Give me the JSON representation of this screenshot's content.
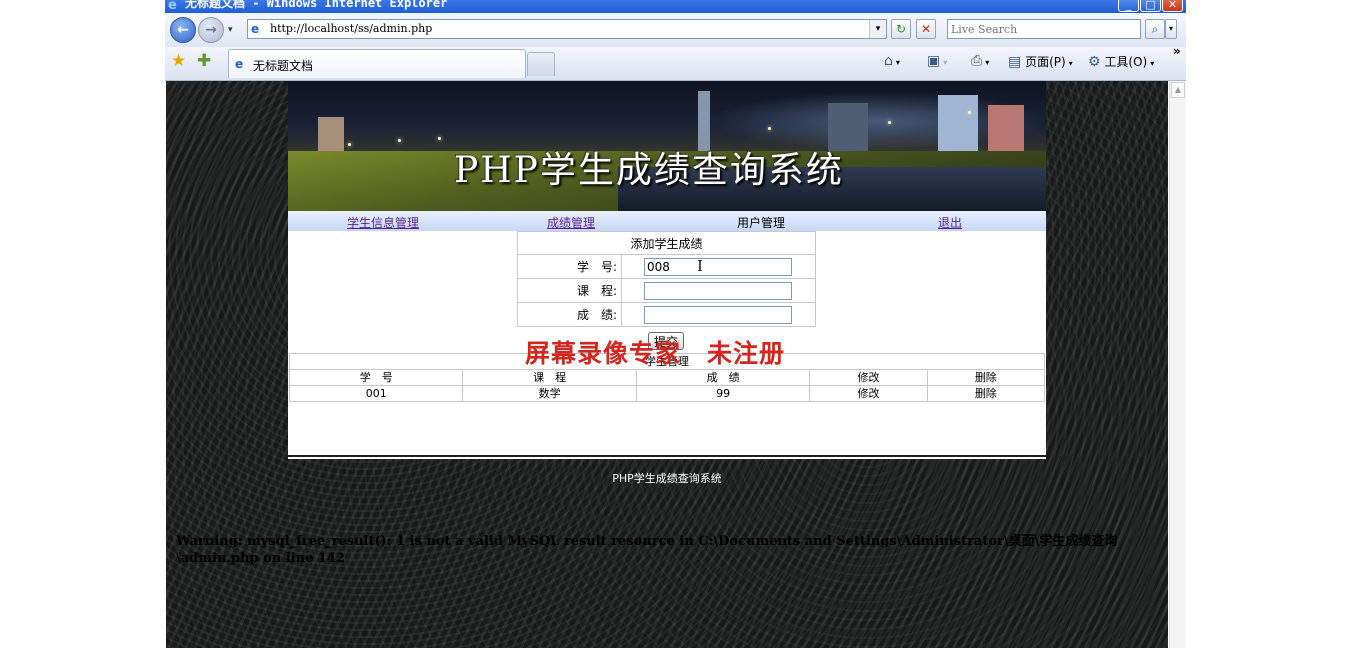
{
  "window": {
    "title": "无标题文档 - Windows Internet Explorer",
    "minimize": "_",
    "maximize": "□",
    "close": "✕"
  },
  "toolbar": {
    "back": "←",
    "forward": "→",
    "nav_dropdown": "▾",
    "address": "http://localhost/ss/admin.php",
    "address_dropdown": "▾",
    "refresh": "↻",
    "stop": "✕",
    "search_placeholder": "Live Search",
    "search_go": "⌕",
    "search_dropdown": "▾"
  },
  "tabs": {
    "active_label": "无标题文档"
  },
  "commands": {
    "home": "⌂",
    "feeds": "▣",
    "print": "⎙",
    "page_label": "页面(P)",
    "tools_label": "工具(O)",
    "more": "»"
  },
  "page": {
    "banner_title": "PHP学生成绩查询系统",
    "menu": {
      "student_info": "学生信息管理",
      "score_mgmt": "成绩管理",
      "user_mgmt": "用户管理",
      "logout": "退出"
    },
    "form": {
      "caption": "添加学生成绩",
      "student_id_label": "学　号:",
      "student_id_value": "008",
      "course_label": "课　程:",
      "course_value": "",
      "score_label": "成　绩:",
      "score_value": "",
      "submit_label": "提交"
    },
    "watermark": "屏幕录像专家　未注册",
    "table": {
      "title": "学生管理",
      "headers": [
        "学　号",
        "课　程",
        "成　绩",
        "修改",
        "删除"
      ],
      "rows": [
        [
          "001",
          "数学",
          "99",
          "修改",
          "删除"
        ]
      ]
    },
    "footer": "PHP学生成绩查询系统",
    "warning": "Warning: mysql_free_result(): 1 is not a valid MySQL result resource in C:\\Documents and Settings\\Administrator\\桌面\\学生成绩查询\\admin.php on line 142"
  }
}
